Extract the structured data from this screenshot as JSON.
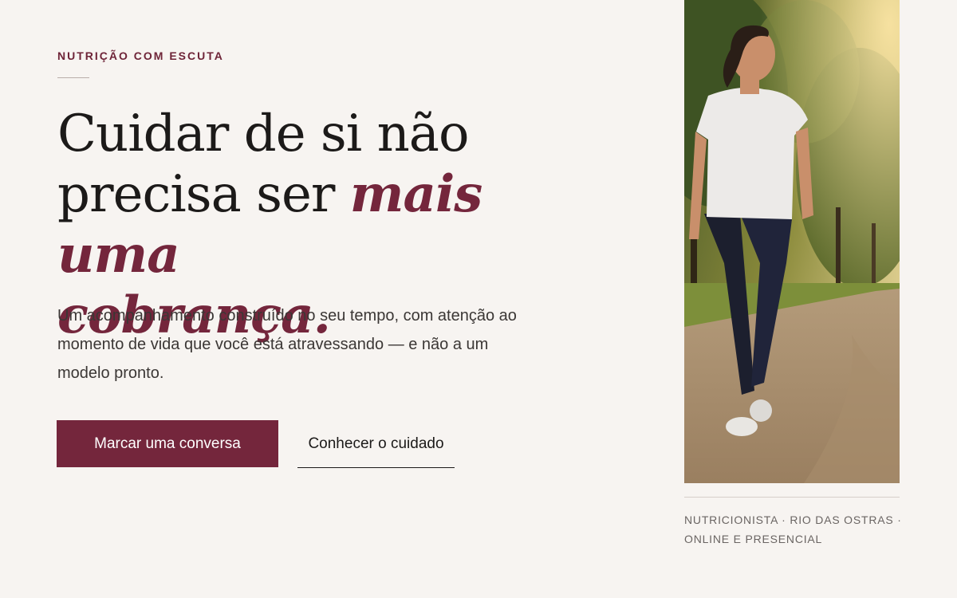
{
  "hero": {
    "eyebrow": "NUTRIÇÃO COM ESCUTA",
    "headline_line1": "Cuidar de si não",
    "headline_line2_plain": "precisa ser ",
    "headline_line2_accent": "mais uma",
    "headline_line3_accent": "cobrança.",
    "lede": "Um acompanhamento construído no seu tempo, com atenção ao momento de vida que você está atravessando — e não a um modelo pronto.",
    "cta_primary": "Marcar uma conversa",
    "cta_secondary": "Conhecer o cuidado"
  },
  "aside": {
    "photo_icon": "woman-walking-in-park-photo",
    "caption_line1": "NUTRICIONISTA · RIO DAS OSTRAS ·",
    "caption_line2": "ONLINE E PRESENCIAL"
  },
  "colors": {
    "background": "#f7f4f1",
    "accent": "#74263c",
    "text": "#1c1a19"
  }
}
